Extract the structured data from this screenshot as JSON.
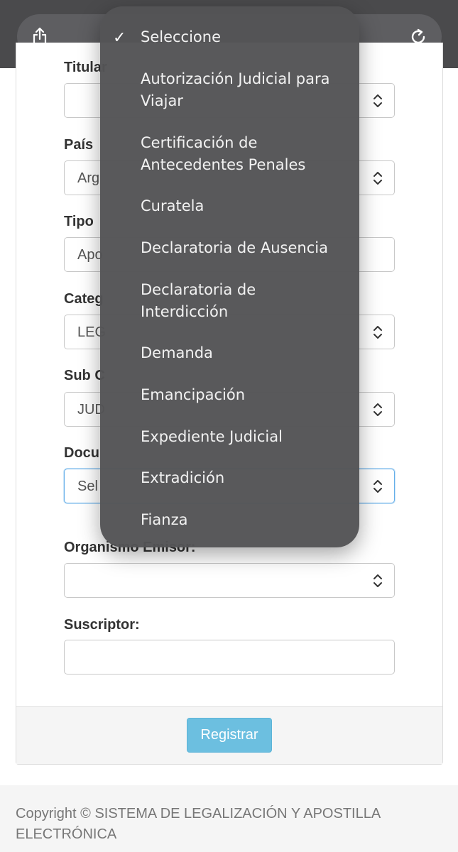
{
  "browser": {
    "share_icon": "share-icon",
    "reload_icon": "reload-icon"
  },
  "form": {
    "fields": [
      {
        "label": "Titular",
        "value": ""
      },
      {
        "label": "País",
        "value": "Arg"
      },
      {
        "label": "Tipo",
        "value": "Apo"
      },
      {
        "label": "Categ",
        "value": "LEG"
      },
      {
        "label": "Sub C",
        "value": "JUD"
      },
      {
        "label": "Docu",
        "value": "Sel"
      },
      {
        "label": "Organismo Emisor:",
        "value": ""
      },
      {
        "label": "Suscriptor:",
        "value": ""
      }
    ],
    "submit_label": "Registrar"
  },
  "dropdown": {
    "selected_index": 0,
    "options": [
      "Seleccione",
      "Autorización Judicial para Viajar",
      "Certificación de Antecedentes Penales",
      "Curatela",
      "Declaratoria de Ausencia",
      "Declaratoria de Interdicción",
      "Demanda",
      "Emancipación",
      "Expediente Judicial",
      "Extradición",
      "Fianza"
    ]
  },
  "footer": {
    "copyright": "Copyright © SISTEMA DE LEGALIZACIÓN Y APOSTILLA ELECTRÓNICA"
  },
  "colors": {
    "accent": "#66afe9",
    "button": "#6cbfe0",
    "popup": "#545456"
  }
}
